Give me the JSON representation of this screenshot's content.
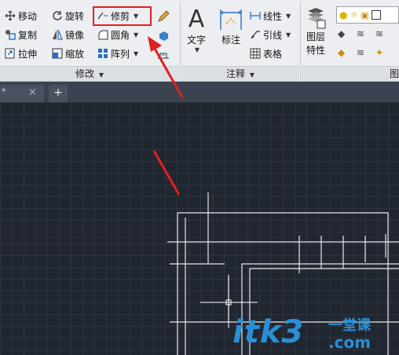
{
  "modify_panel": {
    "title": "修改",
    "items": {
      "move": "移动",
      "rotate": "旋转",
      "trim": "修剪",
      "copy": "复制",
      "mirror": "镜像",
      "fillet": "圆角",
      "stretch": "拉伸",
      "scale": "缩放",
      "array": "阵列"
    }
  },
  "annotation_panel": {
    "title": "注释",
    "items": {
      "text": "文字",
      "dimension": "标注",
      "linear": "线性",
      "leader": "引线",
      "table": "表格"
    }
  },
  "layer_panel": {
    "title": "图层",
    "items": {
      "layer_properties_line1": "图层",
      "layer_properties_line2": "特性"
    }
  },
  "tabs": {
    "active_tab_marker": "*",
    "close_glyph": "×",
    "new_tab_glyph": "+"
  },
  "watermark": {
    "brand": "itk3",
    "domain_suffix": ".com",
    "slogan": "一堂课"
  },
  "colors": {
    "highlight_box": "#e02020",
    "arrow": "#e02020",
    "canvas_background": "#212730",
    "drawing_lines": "#e8e8e8",
    "watermark": "#2a8fd6"
  }
}
